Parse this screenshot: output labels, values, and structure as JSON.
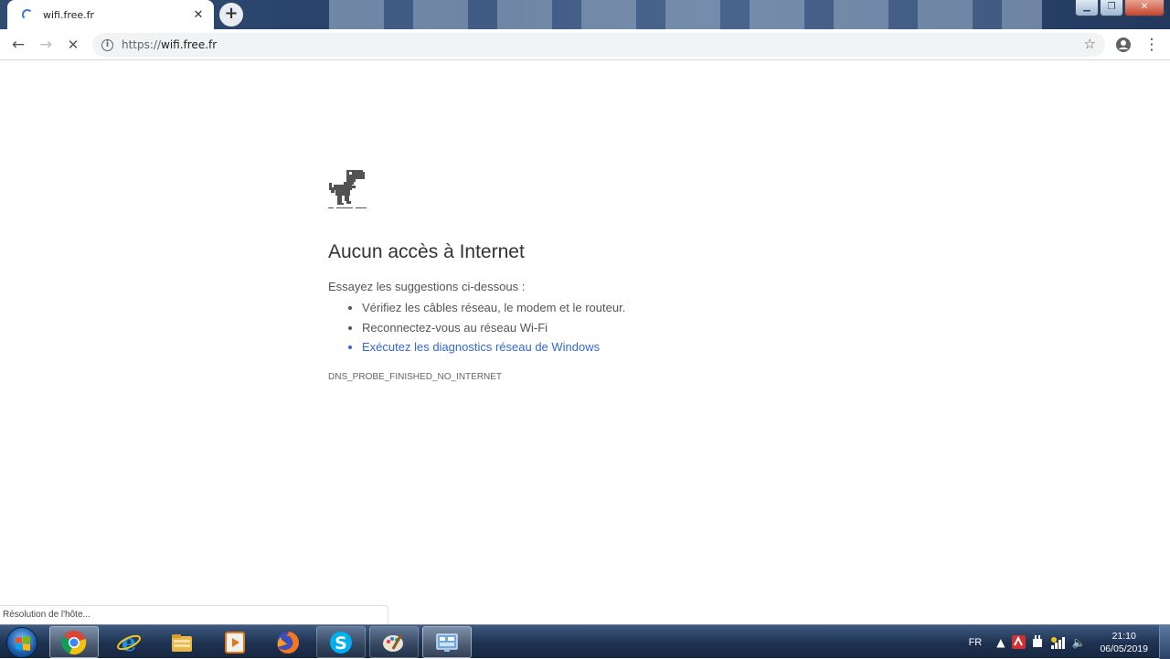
{
  "browser": {
    "tab": {
      "title": "wifi.free.fr",
      "close": "✕"
    },
    "new_tab": "+",
    "window": {
      "minimize": "▁",
      "maximize": "❐",
      "close": "✕"
    },
    "toolbar": {
      "back": "←",
      "forward": "→",
      "stop": "✕",
      "url_scheme": "https://",
      "url_host": "wifi.free.fr",
      "star": "☆",
      "account": "●",
      "menu": "⋮"
    }
  },
  "page": {
    "heading": "Aucun accès à Internet",
    "intro": "Essayez les suggestions ci-dessous :",
    "suggestions": [
      "Vérifiez les câbles réseau, le modem et le routeur.",
      "Reconnectez-vous au réseau Wi-Fi",
      "Exécutez les diagnostics réseau de Windows"
    ],
    "error_code": "DNS_PROBE_FINISHED_NO_INTERNET"
  },
  "status_bar": {
    "text": "Résolution de l'hôte..."
  },
  "taskbar": {
    "apps": [
      "chrome-icon",
      "internet-explorer-icon",
      "file-explorer-icon",
      "media-player-icon",
      "firefox-icon",
      "skype-icon",
      "paint-icon",
      "control-panel-icon"
    ],
    "tray": {
      "language": "FR",
      "time": "21:10",
      "date": "06/05/2019"
    }
  },
  "colors": {
    "link": "#3367d6",
    "text": "#333333",
    "omnibox_bg": "#f1f3f4",
    "taskbar": "#1e3250"
  }
}
